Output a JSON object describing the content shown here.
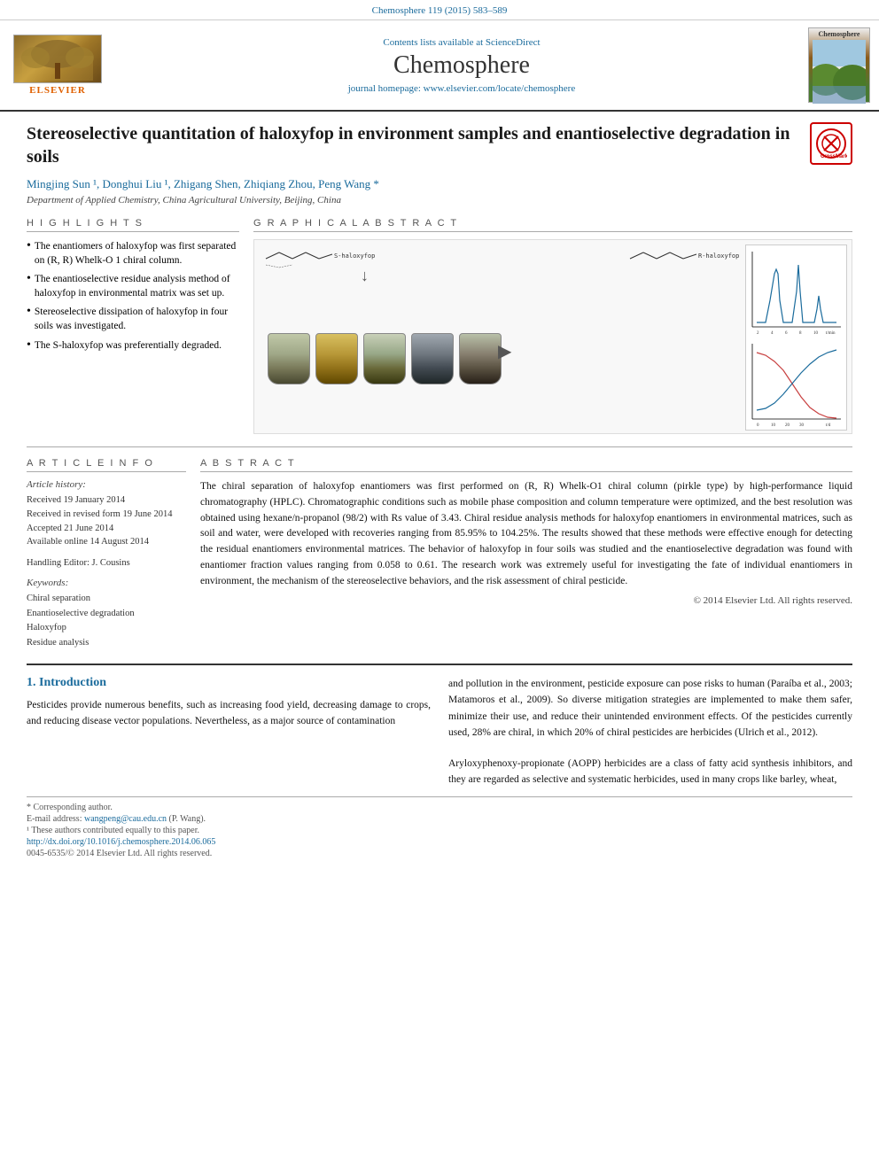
{
  "journal": {
    "citation": "Chemosphere 119 (2015) 583–589",
    "contents_available": "Contents lists available at",
    "sciencedirect": "ScienceDirect",
    "title": "Chemosphere",
    "homepage": "journal homepage: www.elsevier.com/locate/chemosphere",
    "elsevier_label": "ELSEVIER",
    "thumb_label": "Chemosphere"
  },
  "article": {
    "title": "Stereoselective quantitation of haloxyfop in environment samples and enantioselective degradation in soils",
    "crossmark_symbol": "✓",
    "authors": "Mingjing Sun",
    "author_list": "Mingjing Sun ¹, Donghui Liu ¹, Zhigang Shen, Zhiqiang Zhou, Peng Wang *",
    "affiliation": "Department of Applied Chemistry, China Agricultural University, Beijing, China"
  },
  "highlights": {
    "heading": "H I G H L I G H T S",
    "items": [
      "The enantiomers of haloxyfop was first separated on (R, R) Whelk-O 1 chiral column.",
      "The enantioselective residue analysis method of haloxyfop in environmental matrix was set up.",
      "Stereoselective dissipation of haloxyfop in four soils was investigated.",
      "The S-haloxyfop was preferentially degraded."
    ]
  },
  "graphical_abstract": {
    "heading": "G R A P H I C A L   A B S T R A C T"
  },
  "article_info": {
    "heading": "A R T I C L E   I N F O",
    "history_label": "Article history:",
    "received": "Received 19 January 2014",
    "revised": "Received in revised form 19 June 2014",
    "accepted": "Accepted 21 June 2014",
    "available": "Available online 14 August 2014",
    "handling_editor": "Handling Editor: J. Cousins",
    "keywords_label": "Keywords:",
    "keywords": [
      "Chiral separation",
      "Enantioselective degradation",
      "Haloxyfop",
      "Residue analysis"
    ]
  },
  "abstract": {
    "heading": "A B S T R A C T",
    "text": "The chiral separation of haloxyfop enantiomers was first performed on (R, R) Whelk-O1 chiral column (pirkle type) by high-performance liquid chromatography (HPLC). Chromatographic conditions such as mobile phase composition and column temperature were optimized, and the best resolution was obtained using hexane/n-propanol (98/2) with Rs value of 3.43. Chiral residue analysis methods for haloxyfop enantiomers in environmental matrices, such as soil and water, were developed with recoveries ranging from 85.95% to 104.25%. The results showed that these methods were effective enough for detecting the residual enantiomers environmental matrices. The behavior of haloxyfop in four soils was studied and the enantioselective degradation was found with enantiomer fraction values ranging from 0.058 to 0.61. The research work was extremely useful for investigating the fate of individual enantiomers in environment, the mechanism of the stereoselective behaviors, and the risk assessment of chiral pesticide.",
    "copyright": "© 2014 Elsevier Ltd. All rights reserved."
  },
  "introduction": {
    "heading": "1. Introduction",
    "left_text": "Pesticides provide numerous benefits, such as increasing food yield, decreasing damage to crops, and reducing disease vector populations. Nevertheless, as a major source of contamination",
    "right_text": "and pollution in the environment, pesticide exposure can pose risks to human (Paraíba et al., 2003; Matamoros et al., 2009). So diverse mitigation strategies are implemented to make them safer, minimize their use, and reduce their unintended environment effects. Of the pesticides currently used, 28% are chiral, in which 20% of chiral pesticides are herbicides (Ulrich et al., 2012).",
    "right_text2": "Aryloxyphenoxy-propionate (AOPP) herbicides are a class of fatty acid synthesis inhibitors, and they are regarded as selective and systematic herbicides, used in many crops like barley, wheat,"
  },
  "footer": {
    "corresponding_label": "* Corresponding author.",
    "email_label": "E-mail address:",
    "email": "wangpeng@cau.edu.cn",
    "email_person": "(P. Wang).",
    "footnote1": "¹ These authors contributed equally to this paper.",
    "doi": "http://dx.doi.org/10.1016/j.chemosphere.2014.06.065",
    "issn": "0045-6535/© 2014 Elsevier Ltd. All rights reserved."
  }
}
